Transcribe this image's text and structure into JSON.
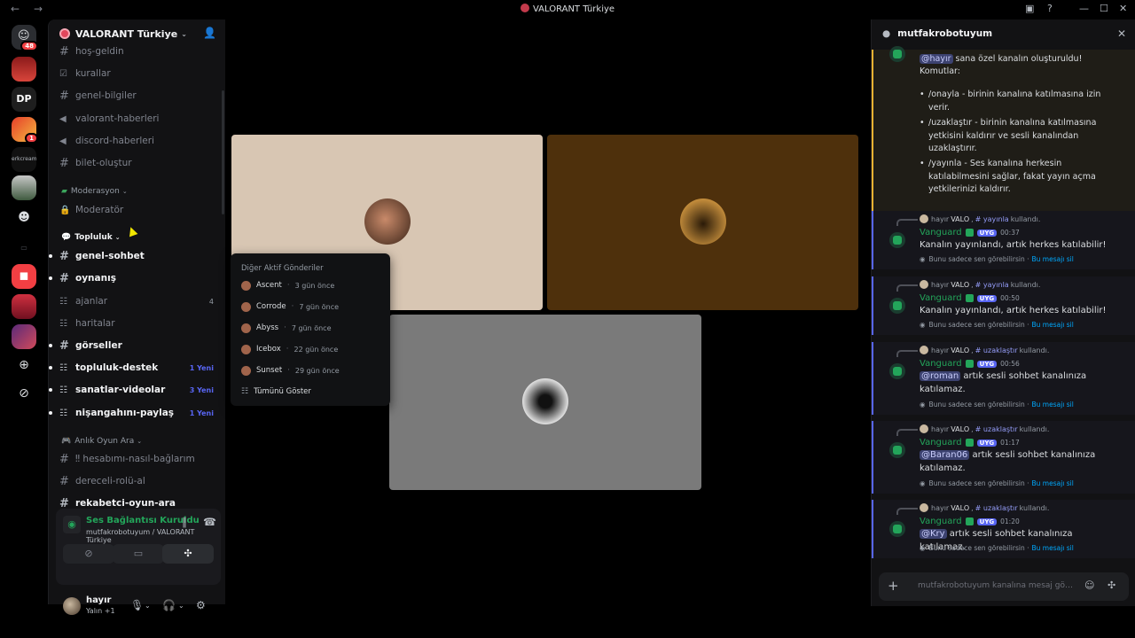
{
  "window": {
    "title": "VALORANT Türkiye",
    "back_icon": "←",
    "forward_icon": "→"
  },
  "rail": {
    "home_badge": "48",
    "server2_badge": "1"
  },
  "server": {
    "name": "VALORANT Türkiye"
  },
  "channels": {
    "top": [
      {
        "label": "hoş-geldin",
        "icon": "#"
      },
      {
        "label": "kurallar",
        "icon": "☑"
      },
      {
        "label": "genel-bilgiler",
        "icon": "#"
      },
      {
        "label": "valorant-haberleri",
        "icon": "📢"
      },
      {
        "label": "discord-haberleri",
        "icon": "📢"
      },
      {
        "label": "bilet-oluştur",
        "icon": "#"
      }
    ],
    "moderation_category": "Moderasyon",
    "moderator": "Moderatör",
    "community_category": "Topluluk",
    "community": [
      {
        "label": "genel-sohbet",
        "icon": "#",
        "count": "",
        "new": ""
      },
      {
        "label": "oynanış",
        "icon": "#",
        "count": "",
        "new": ""
      },
      {
        "label": "ajanlar",
        "icon": "☷",
        "count": "4",
        "new": ""
      },
      {
        "label": "haritalar",
        "icon": "☷",
        "count": "",
        "new": ""
      },
      {
        "label": "görseller",
        "icon": "#",
        "count": "",
        "new": ""
      },
      {
        "label": "topluluk-destek",
        "icon": "☷",
        "count": "",
        "new": "1 Yeni"
      },
      {
        "label": "sanatlar-videolar",
        "icon": "☷",
        "count": "",
        "new": "3 Yeni"
      },
      {
        "label": "nişangahını-paylaş",
        "icon": "☷",
        "count": "",
        "new": "1 Yeni"
      }
    ],
    "lfg_category": "Anlık Oyun Ara",
    "lfg": [
      {
        "label": "‼ hesabımı-nasıl-bağlarım",
        "icon": "#"
      },
      {
        "label": "dereceli-rolü-al",
        "icon": "#"
      },
      {
        "label": "rekabetci-oyun-ara",
        "icon": "#"
      }
    ]
  },
  "voice": {
    "status": "Ses Bağlantısı Kuruldu",
    "channel": "mutfakrobotuyum / VALORANT Türkiye"
  },
  "user": {
    "name": "hayır",
    "status": "Yalın +1"
  },
  "popup": {
    "header": "Diğer Aktif Gönderiler",
    "items": [
      {
        "name": "Ascent",
        "ago": "3 gün önce"
      },
      {
        "name": "Corrode",
        "ago": "7 gün önce"
      },
      {
        "name": "Abyss",
        "ago": "7 gün önce"
      },
      {
        "name": "Icebox",
        "ago": "22 gün önce"
      },
      {
        "name": "Sunset",
        "ago": "29 gün önce"
      }
    ],
    "show_all": "Tümünü Göster"
  },
  "thread": {
    "title": "mutfakrobotuyum",
    "first_mention": "@hayır",
    "first_line": " sana özel kanalın oluşturuldu!",
    "commands_label": "Komutlar:",
    "bullets": [
      "/onayla - birinin kanalına katılmasına izin verir.",
      "/uzaklaştır - birinin kanalına katılmasına yetkisini kaldırır ve sesli kanalından uzaklaştırır.",
      "/yayınla - Ses kanalına herkesin katılabilmesini sağlar, fakat yayın açma yetkilerinizi kaldırır."
    ],
    "messages": [
      {
        "user": "hayır",
        "tag": "VALO",
        "cmd": "# yayınla",
        "used": "kullandı.",
        "bot": "Vanguard",
        "app": "UYG",
        "time": "00:37",
        "mention": "",
        "text": "Kanalın yayınlandı, artık herkes katılabilir!",
        "eph": "Bunu sadece sen görebilirsin ·",
        "del": "Bu mesajı sil"
      },
      {
        "user": "hayır",
        "tag": "VALO",
        "cmd": "# yayınla",
        "used": "kullandı.",
        "bot": "Vanguard",
        "app": "UYG",
        "time": "00:50",
        "mention": "",
        "text": "Kanalın yayınlandı, artık herkes katılabilir!",
        "eph": "Bunu sadece sen görebilirsin ·",
        "del": "Bu mesajı sil"
      },
      {
        "user": "hayır",
        "tag": "VALO",
        "cmd": "# uzaklaştır",
        "used": "kullandı.",
        "bot": "Vanguard",
        "app": "UYG",
        "time": "00:56",
        "mention": "@roman",
        "text": " artık sesli sohbet kanalınıza katılamaz.",
        "eph": "Bunu sadece sen görebilirsin ·",
        "del": "Bu mesajı sil"
      },
      {
        "user": "hayır",
        "tag": "VALO",
        "cmd": "# uzaklaştır",
        "used": "kullandı.",
        "bot": "Vanguard",
        "app": "UYG",
        "time": "01:17",
        "mention": "@Baran06",
        "text": " artık sesli sohbet kanalınıza katılamaz.",
        "eph": "Bunu sadece sen görebilirsin ·",
        "del": "Bu mesajı sil"
      },
      {
        "user": "hayır",
        "tag": "VALO",
        "cmd": "# uzaklaştır",
        "used": "kullandı.",
        "bot": "Vanguard",
        "app": "UYG",
        "time": "01:20",
        "mention": "@Kry",
        "text": " artık sesli sohbet kanalınıza katılamaz.",
        "eph": "Bunu sadece sen görebilirsin ·",
        "del": "Bu mesajı sil"
      }
    ],
    "composer_placeholder": "mutfakrobotuyum kanalına mesaj gönder"
  },
  "colors": {
    "tile1": "#d8c6b3",
    "tile2": "#4e300c",
    "tile3": "#7a7a7a",
    "green": "#23a55a",
    "blurple": "#5865f2"
  }
}
